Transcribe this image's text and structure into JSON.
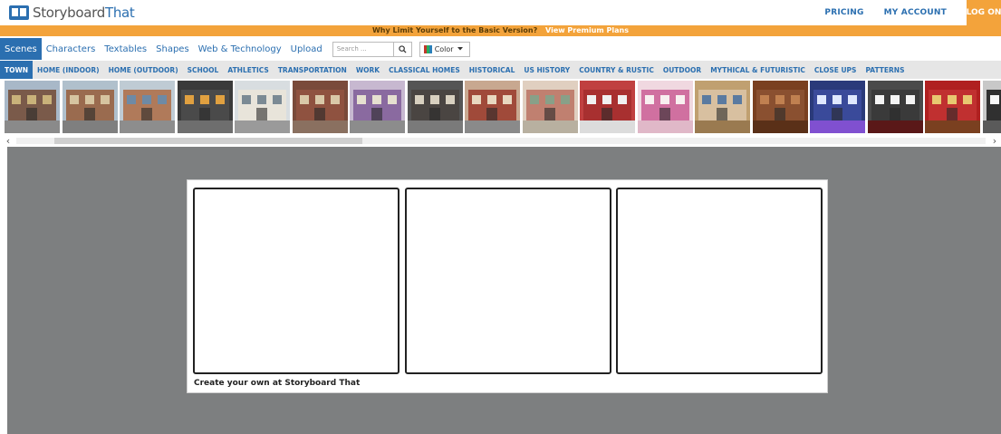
{
  "header": {
    "logo_prefix": "Storyboard",
    "logo_suffix": "That",
    "links": [
      "PRICING",
      "MY ACCOUNT"
    ],
    "login_label": "LOG ON"
  },
  "promo": {
    "text": "Why Limit Yourself to the Basic Version?",
    "link": "View Premium Plans"
  },
  "tools": {
    "tabs": [
      "Scenes",
      "Characters",
      "Textables",
      "Shapes",
      "Web & Technology",
      "Upload"
    ],
    "active_tab": "Scenes",
    "search_placeholder": "Search ...",
    "color_label": "Color"
  },
  "categories": {
    "items": [
      "TOWN",
      "HOME (INDOOR)",
      "HOME (OUTDOOR)",
      "SCHOOL",
      "ATHLETICS",
      "TRANSPORTATION",
      "WORK",
      "CLASSICAL HOMES",
      "HISTORICAL",
      "US HISTORY",
      "COUNTRY & RUSTIC",
      "OUTDOOR",
      "MYTHICAL & FUTURISTIC",
      "CLOSE UPS",
      "PATTERNS"
    ],
    "active": "TOWN"
  },
  "scenes": [
    {
      "name": "town-street-scene",
      "sky": "#a8b8c8",
      "ground": "#8a8a8a",
      "building": "#7a5a4a",
      "accent": "#c9b27a"
    },
    {
      "name": "row-houses-scene",
      "sky": "#b0c0cc",
      "ground": "#7f7f7f",
      "building": "#9a6b4f",
      "accent": "#d6c4a0"
    },
    {
      "name": "corner-street-scene",
      "sky": "#bfcbd4",
      "ground": "#8d8d8d",
      "building": "#b07a5a",
      "accent": "#6e8aa5"
    },
    {
      "name": "storefront-display-scene",
      "sky": "#3a3a3a",
      "ground": "#6e6e6e",
      "building": "#4a4a4a",
      "accent": "#e0a040"
    },
    {
      "name": "white-house-scene",
      "sky": "#d8dde0",
      "ground": "#9a9a9a",
      "building": "#e8e4da",
      "accent": "#7b8a94"
    },
    {
      "name": "brick-shop-scene",
      "sky": "#7a4a3a",
      "ground": "#8a7060",
      "building": "#8f5240",
      "accent": "#d9c8a8"
    },
    {
      "name": "purple-awning-scene",
      "sky": "#c7b8d0",
      "ground": "#8c8c8c",
      "building": "#8a6aa0",
      "accent": "#e6e0d0"
    },
    {
      "name": "dark-storefront-scene",
      "sky": "#555555",
      "ground": "#7a7a7a",
      "building": "#4a4542",
      "accent": "#d8d0c0"
    },
    {
      "name": "red-door-shop-scene",
      "sky": "#c8a890",
      "ground": "#8a8a8a",
      "building": "#a04a3a",
      "accent": "#e8d8c0"
    },
    {
      "name": "deli-interior-scene",
      "sky": "#e0cfc0",
      "ground": "#b8b0a0",
      "building": "#c08070",
      "accent": "#88a088"
    },
    {
      "name": "diner-counter-scene",
      "sky": "#c04040",
      "ground": "#dcdcdc",
      "building": "#a83030",
      "accent": "#f0f0f0"
    },
    {
      "name": "bakery-counter-scene",
      "sky": "#f0d8e0",
      "ground": "#e0b8c8",
      "building": "#d070a0",
      "accent": "#f8f0f0"
    },
    {
      "name": "office-bulletin-scene",
      "sky": "#c0a070",
      "ground": "#9a7a50",
      "building": "#d8c0a0",
      "accent": "#5a7aa0"
    },
    {
      "name": "cafe-interior-scene",
      "sky": "#7a4020",
      "ground": "#5a3018",
      "building": "#8a5030",
      "accent": "#c08050"
    },
    {
      "name": "dance-floor-scene",
      "sky": "#2a3a7a",
      "ground": "#8050d0",
      "building": "#3a4a9a",
      "accent": "#e0e8ff"
    },
    {
      "name": "cinema-screen-scene",
      "sky": "#4a4a4a",
      "ground": "#5a1818",
      "building": "#3a3a3a",
      "accent": "#f4f4f4"
    },
    {
      "name": "theater-stage-scene",
      "sky": "#b02020",
      "ground": "#7a4020",
      "building": "#c03030",
      "accent": "#e8c870"
    },
    {
      "name": "presentation-room-scene",
      "sky": "#c8c8c8",
      "ground": "#5a5a5a",
      "building": "#303030",
      "accent": "#f8f8f8"
    }
  ],
  "storyboard": {
    "cells": [
      "cell-1",
      "cell-2",
      "cell-3"
    ],
    "caption": "Create your own at Storyboard That"
  }
}
